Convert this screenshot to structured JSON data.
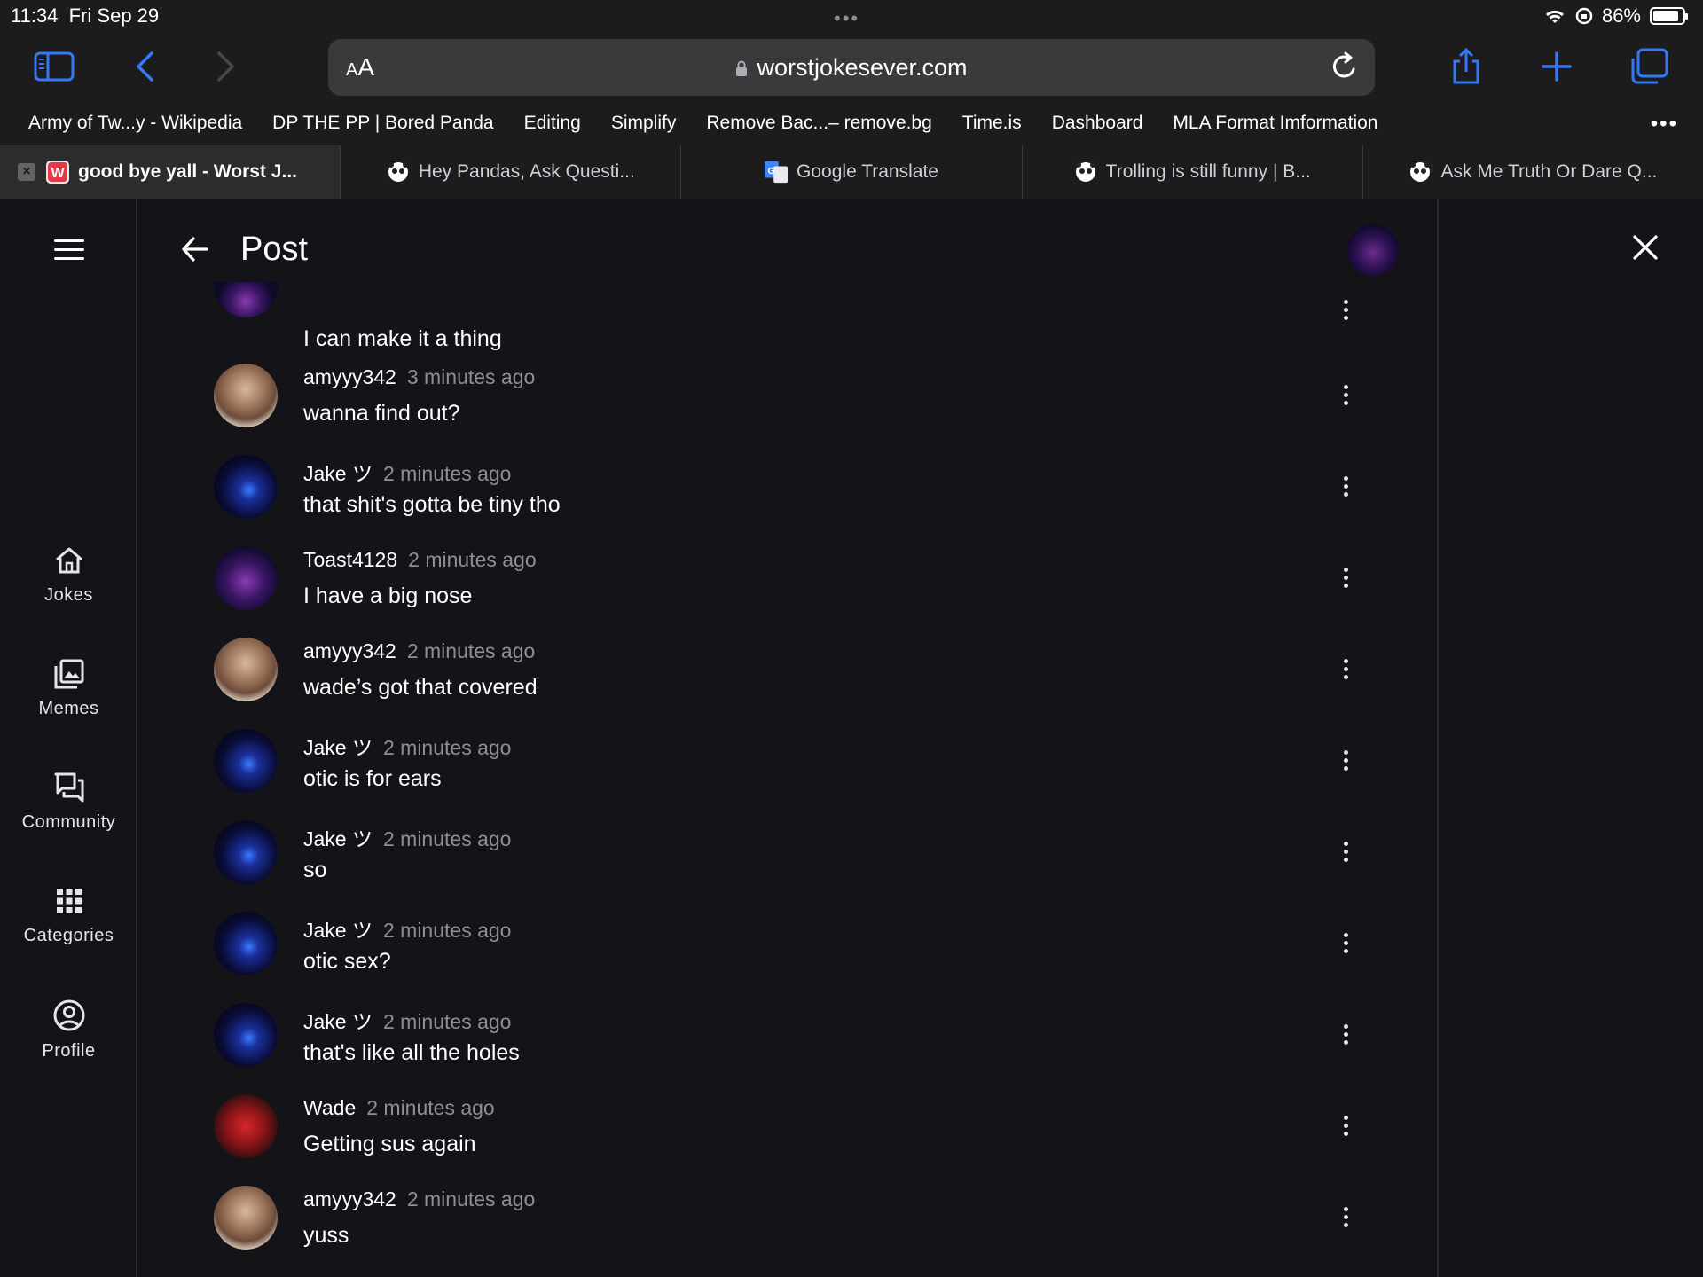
{
  "status": {
    "time": "11:34",
    "date": "Fri Sep 29",
    "battery": "86%",
    "battery_level": 0.86
  },
  "browser": {
    "url_aa": "AA",
    "url": "worstjokesever.com",
    "bookmarks": [
      "Army of Tw...y - Wikipedia",
      "DP THE PP | Bored Panda",
      "Editing",
      "Simplify",
      "Remove Bac...– remove.bg",
      "Time.is",
      "Dashboard",
      "MLA Format Imformation"
    ],
    "tabs": [
      {
        "label": "good bye yall - Worst J...",
        "active": true
      },
      {
        "label": "Hey Pandas, Ask Questi...",
        "active": false
      },
      {
        "label": "Google Translate",
        "active": false
      },
      {
        "label": "Trolling is still funny | B...",
        "active": false
      },
      {
        "label": "Ask Me Truth Or Dare Q...",
        "active": false
      }
    ]
  },
  "nav": {
    "items": [
      {
        "label": "Jokes",
        "icon": "home-icon"
      },
      {
        "label": "Memes",
        "icon": "image-icon"
      },
      {
        "label": "Community",
        "icon": "forum-icon"
      },
      {
        "label": "Categories",
        "icon": "grid-icon"
      },
      {
        "label": "Profile",
        "icon": "account-icon"
      }
    ]
  },
  "post": {
    "title": "Post",
    "partial_comment": "I can make it a thing",
    "comments": [
      {
        "user": "amyyy342",
        "time": "3 minutes ago",
        "text": "wanna find out?",
        "avatar": "amy"
      },
      {
        "user": "Jake ツ",
        "time": "2 minutes ago",
        "text": "that shit's gotta be tiny tho",
        "avatar": "jake"
      },
      {
        "user": "Toast4128",
        "time": "2 minutes ago",
        "text": "I have a big nose",
        "avatar": "toast"
      },
      {
        "user": "amyyy342",
        "time": "2 minutes ago",
        "text": "wade’s got that covered",
        "avatar": "amy"
      },
      {
        "user": "Jake ツ",
        "time": "2 minutes ago",
        "text": "otic is for ears",
        "avatar": "jake"
      },
      {
        "user": "Jake ツ",
        "time": "2 minutes ago",
        "text": "so",
        "avatar": "jake"
      },
      {
        "user": "Jake ツ",
        "time": "2 minutes ago",
        "text": "otic sex?",
        "avatar": "jake"
      },
      {
        "user": "Jake ツ",
        "time": "2 minutes ago",
        "text": "that's like all the holes",
        "avatar": "jake"
      },
      {
        "user": "Wade",
        "time": "2 minutes ago",
        "text": "Getting sus again",
        "avatar": "wade"
      },
      {
        "user": "amyyy342",
        "time": "2 minutes ago",
        "text": "yuss",
        "avatar": "amy"
      }
    ]
  },
  "colors": {
    "accent": "#3478f6",
    "background": "#131318",
    "muted_text": "#8e8e93"
  }
}
